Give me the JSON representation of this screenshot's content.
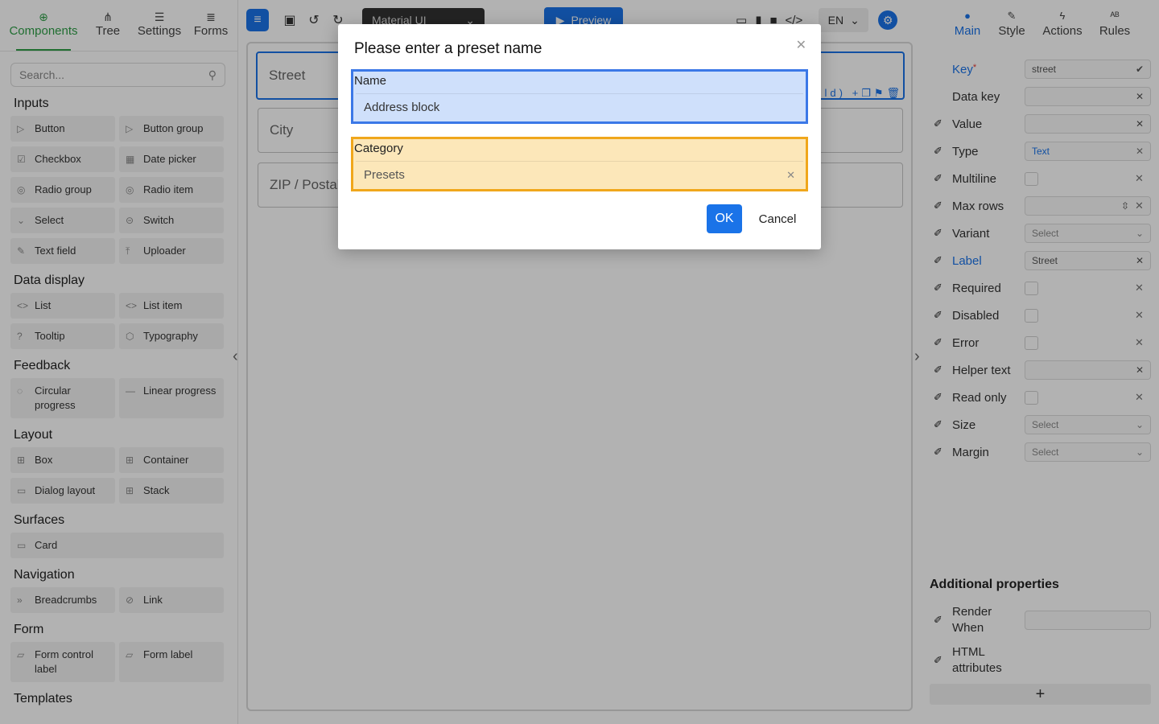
{
  "left_panel": {
    "tabs": [
      {
        "label": "Components",
        "icon": "plus-circle-icon"
      },
      {
        "label": "Tree",
        "icon": "tree-icon"
      },
      {
        "label": "Settings",
        "icon": "sliders-icon"
      },
      {
        "label": "Forms",
        "icon": "list-icon"
      }
    ],
    "search_placeholder": "Search...",
    "sections": {
      "inputs": "Inputs",
      "data_display": "Data display",
      "feedback": "Feedback",
      "layout": "Layout",
      "surfaces": "Surfaces",
      "navigation": "Navigation",
      "form": "Form",
      "templates": "Templates"
    },
    "inputs": [
      "Button",
      "Button group",
      "Checkbox",
      "Date picker",
      "Radio group",
      "Radio item",
      "Select",
      "Switch",
      "Text field",
      "Uploader"
    ],
    "data_display": [
      "List",
      "List item",
      "Tooltip",
      "Typography"
    ],
    "feedback": [
      "Circular progress",
      "Linear progress"
    ],
    "layout": [
      "Box",
      "Container",
      "Dialog layout",
      "Stack"
    ],
    "surfaces": [
      "Card"
    ],
    "navigation": [
      "Breadcrumbs",
      "Link"
    ],
    "form": [
      "Form control label",
      "Form label"
    ]
  },
  "toolbar": {
    "theme": "Material UI",
    "preview": "Preview",
    "language": "EN"
  },
  "canvas": {
    "fields": [
      "Street",
      "City",
      "ZIP / Postal"
    ],
    "tools_text": "ld)"
  },
  "right_panel": {
    "tabs": [
      {
        "label": "Main",
        "icon": "circle-icon"
      },
      {
        "label": "Style",
        "icon": "brush-icon"
      },
      {
        "label": "Actions",
        "icon": "bolt-icon"
      },
      {
        "label": "Rules",
        "icon": "rules-icon"
      }
    ],
    "props": [
      {
        "label": "Key",
        "value": "street",
        "required_mark": "*"
      },
      {
        "label": "Data key",
        "value": ""
      },
      {
        "label": "Value",
        "value": ""
      },
      {
        "label": "Type",
        "value": "Text"
      },
      {
        "label": "Multiline",
        "value": ""
      },
      {
        "label": "Max rows",
        "value": ""
      },
      {
        "label": "Variant",
        "value": "Select"
      },
      {
        "label": "Label",
        "value": "Street"
      },
      {
        "label": "Required",
        "value": ""
      },
      {
        "label": "Disabled",
        "value": ""
      },
      {
        "label": "Error",
        "value": ""
      },
      {
        "label": "Helper text",
        "value": ""
      },
      {
        "label": "Read only",
        "value": ""
      },
      {
        "label": "Size",
        "value": "Select"
      },
      {
        "label": "Margin",
        "value": "Select"
      }
    ],
    "additional_title": "Additional properties",
    "additional": [
      {
        "label": "Render When"
      },
      {
        "label": "HTML attributes"
      }
    ],
    "add_label": "+"
  },
  "dialog": {
    "title": "Please enter a preset name",
    "name_label": "Name",
    "name_value": "Address block",
    "category_label": "Category",
    "category_value": "Presets",
    "ok_label": "OK",
    "cancel_label": "Cancel"
  },
  "colors": {
    "accent_blue": "#1a73e8",
    "components_green": "#2e9e47",
    "name_highlight": "#3b78e7",
    "category_highlight": "#f0a71c"
  }
}
